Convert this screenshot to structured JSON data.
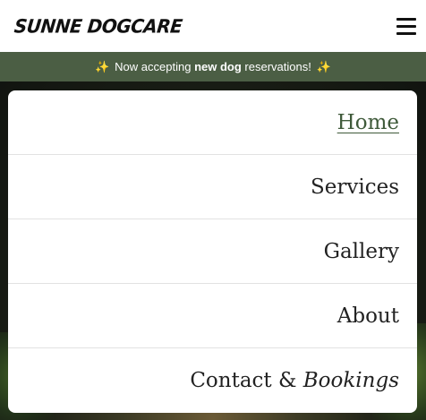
{
  "header": {
    "logo_text": "SUNNE DOGCARE",
    "menu_icon": "hamburger-icon"
  },
  "banner": {
    "icon": "sparkle-icon",
    "prefix": "Now accepting",
    "bold": "new dog",
    "suffix": "reservations!"
  },
  "nav": {
    "items": [
      {
        "label": "Home",
        "active": true
      },
      {
        "label": "Services",
        "active": false
      },
      {
        "label": "Gallery",
        "active": false
      },
      {
        "label": "About",
        "active": false
      },
      {
        "label_plain": "Contact &",
        "label_italic": "Bookings",
        "active": false
      }
    ]
  },
  "colors": {
    "banner_bg": "#4b5e44",
    "active_link": "#3f5a3a",
    "sparkle": "#f2d14b"
  }
}
